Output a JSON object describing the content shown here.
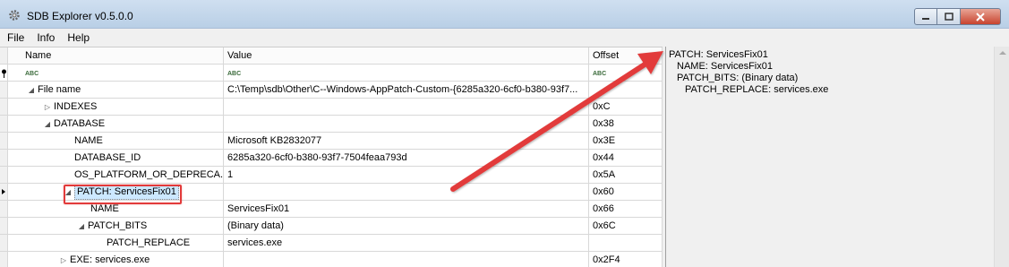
{
  "window": {
    "title": "SDB Explorer v0.5.0.0",
    "icon": "gear-icon"
  },
  "menu": [
    {
      "label": "File"
    },
    {
      "label": "Info"
    },
    {
      "label": "Help"
    }
  ],
  "grid": {
    "columns": {
      "name": "Name",
      "value": "Value",
      "offset": "Offset"
    },
    "filter_placeholder": "ABC",
    "rows": [
      {
        "name": "File name",
        "value": "C:\\Temp\\sdb\\Other\\C--Windows-AppPatch-Custom-{6285a320-6cf0-b380-93f7...",
        "offset": "",
        "expander": "expanded"
      },
      {
        "name": "INDEXES",
        "value": "",
        "offset": "0xC",
        "expander": "collapsed"
      },
      {
        "name": "DATABASE",
        "value": "",
        "offset": "0x38",
        "expander": "expanded"
      },
      {
        "name": "NAME",
        "value": "Microsoft KB2832077",
        "offset": "0x3E",
        "expander": "leaf"
      },
      {
        "name": "DATABASE_ID",
        "value": "6285a320-6cf0-b380-93f7-7504feaa793d",
        "offset": "0x44",
        "expander": "leaf"
      },
      {
        "name": "OS_PLATFORM_OR_DEPRECA...",
        "value": "1",
        "offset": "0x5A",
        "expander": "leaf"
      },
      {
        "name": "PATCH: ServicesFix01",
        "value": "",
        "offset": "0x60",
        "expander": "expanded"
      },
      {
        "name": "NAME",
        "value": "ServicesFix01",
        "offset": "0x66",
        "expander": "leaf"
      },
      {
        "name": "PATCH_BITS",
        "value": "(Binary data)",
        "offset": "0x6C",
        "expander": "expanded"
      },
      {
        "name": "PATCH_REPLACE",
        "value": "services.exe",
        "offset": "",
        "expander": "leaf"
      },
      {
        "name": "EXE: services.exe",
        "value": "",
        "offset": "0x2F4",
        "expander": "collapsed"
      }
    ]
  },
  "detail": {
    "lines": [
      "PATCH: ServicesFix01",
      "NAME: ServicesFix01",
      "PATCH_BITS: (Binary data)",
      "PATCH_REPLACE: services.exe"
    ]
  },
  "colors": {
    "highlight": "#e23a3a",
    "selection": "#cce8ff"
  }
}
